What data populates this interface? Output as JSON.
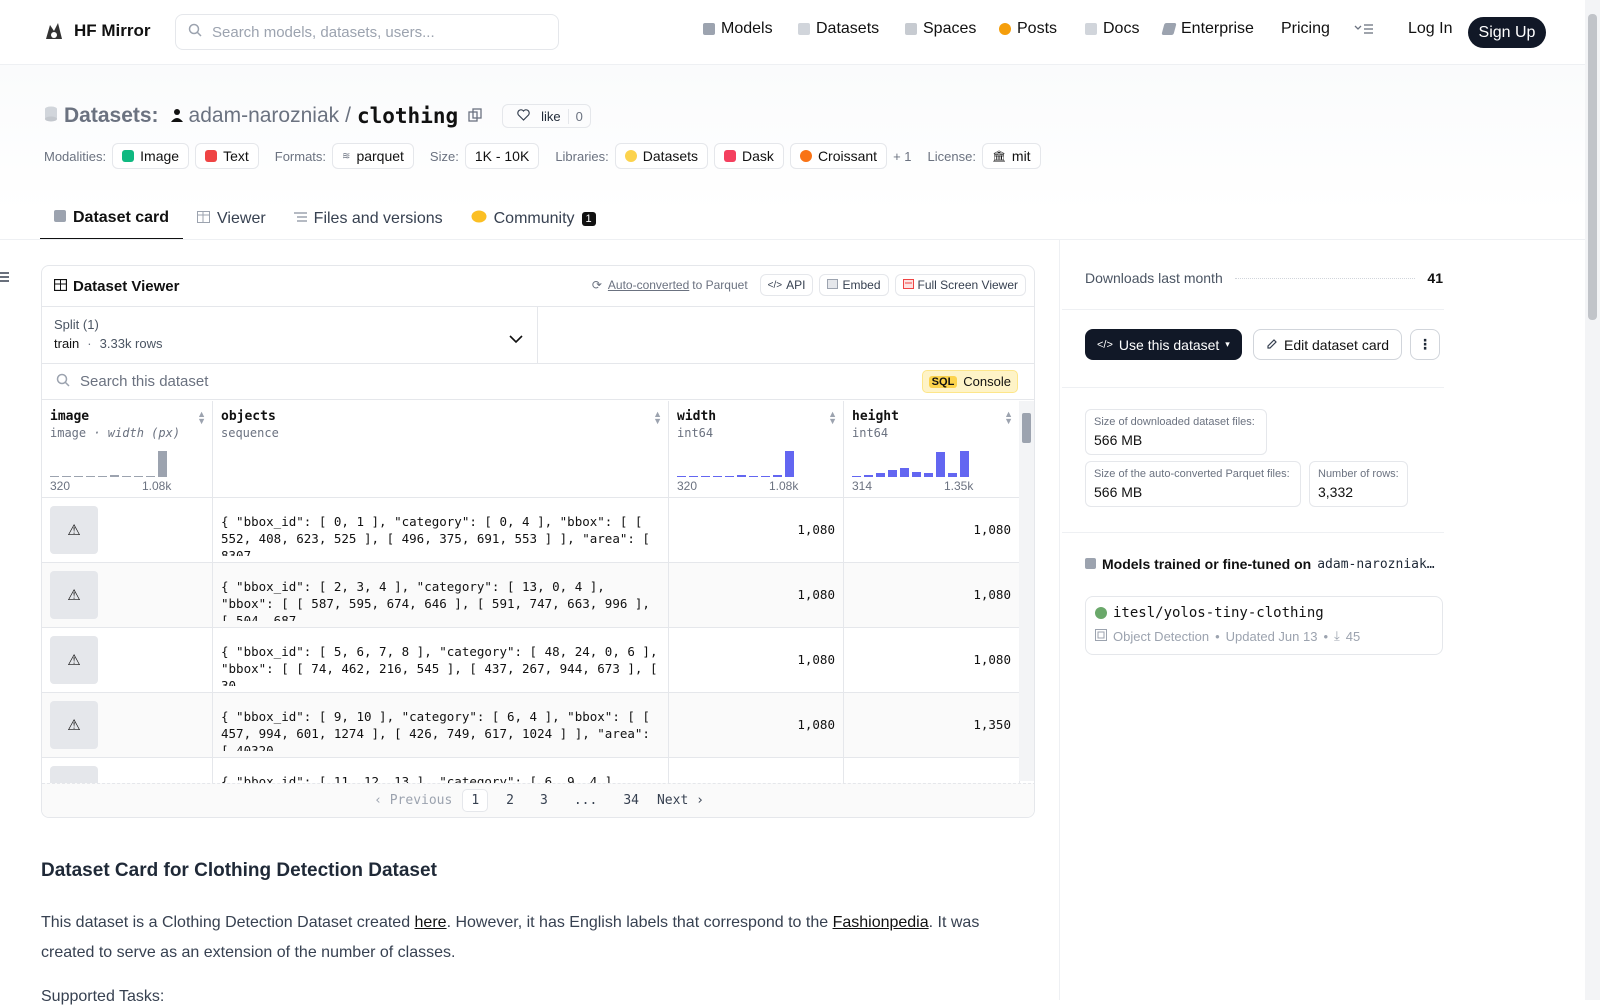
{
  "brand": "HF Mirror",
  "search": {
    "placeholder": "Search models, datasets, users..."
  },
  "nav": {
    "models": "Models",
    "datasets": "Datasets",
    "spaces": "Spaces",
    "posts": "Posts",
    "docs": "Docs",
    "enterprise": "Enterprise",
    "pricing": "Pricing",
    "login": "Log In",
    "signup": "Sign Up"
  },
  "repo": {
    "type_label": "Datasets:",
    "owner": "adam-narozniak",
    "sep": "/",
    "name": "clothing",
    "like": "like",
    "likes": "0"
  },
  "meta": {
    "modalities_label": "Modalities:",
    "modalities": [
      "Image",
      "Text"
    ],
    "formats_label": "Formats:",
    "format": "parquet",
    "size_label": "Size:",
    "size": "1K - 10K",
    "libraries_label": "Libraries:",
    "libraries": [
      "Datasets",
      "Dask",
      "Croissant"
    ],
    "libraries_more": "+ 1",
    "license_label": "License:",
    "license": "mit"
  },
  "tabs": {
    "card": "Dataset card",
    "viewer": "Viewer",
    "files": "Files and versions",
    "community": "Community",
    "community_count": "1"
  },
  "viewer": {
    "title": "Dataset Viewer",
    "auto_converted": "Auto-converted",
    "to_parquet": "to Parquet",
    "api": "API",
    "embed": "Embed",
    "fullscreen": "Full Screen Viewer",
    "split_label": "Split (1)",
    "split_name": "train",
    "split_dot": "·",
    "split_rows": "3.33k rows",
    "search_placeholder": "Search this dataset",
    "sql_tag": "SQL",
    "console": "Console",
    "columns": [
      {
        "name": "image",
        "type": "image",
        "subtype": "· width (px)",
        "min": "320",
        "max": "1.08k"
      },
      {
        "name": "objects",
        "type": "sequence"
      },
      {
        "name": "width",
        "type": "int64",
        "min": "320",
        "max": "1.08k"
      },
      {
        "name": "height",
        "type": "int64",
        "min": "314",
        "max": "1.35k"
      }
    ],
    "rows": [
      {
        "objects": "{ \"bbox_id\": [ 0, 1 ], \"category\": [ 0, 4 ], \"bbox\": [ [ 552, 408, 623, 525 ], [ 496, 375, 691, 553 ] ], \"area\": [ 8307,…",
        "width": "1,080",
        "height": "1,080"
      },
      {
        "objects": "{ \"bbox_id\": [ 2, 3, 4 ], \"category\": [ 13, 0, 4 ], \"bbox\": [ [ 587, 595, 674, 646 ], [ 591, 747, 663, 996 ], [ 504, 687,…",
        "width": "1,080",
        "height": "1,080"
      },
      {
        "objects": "{ \"bbox_id\": [ 5, 6, 7, 8 ], \"category\": [ 48, 24, 0, 6 ], \"bbox\": [ [ 74, 462, 216, 545 ], [ 437, 267, 944, 673 ], [ 30…",
        "width": "1,080",
        "height": "1,080"
      },
      {
        "objects": "{ \"bbox_id\": [ 9, 10 ], \"category\": [ 6, 4 ], \"bbox\": [ [ 457, 994, 601, 1274 ], [ 426, 749, 617, 1024 ] ], \"area\": [ 40320,…",
        "width": "1,080",
        "height": "1,350"
      },
      {
        "objects": "{ \"bbox_id\": [ 11, 12, 13 ], \"category\": [ 6, 9, 4 ], \"bbox\":",
        "width": "",
        "height": ""
      }
    ],
    "pager": {
      "prev": "Previous",
      "pages": [
        "1",
        "2",
        "3",
        "...",
        "34"
      ],
      "next": "Next"
    }
  },
  "card": {
    "heading": "Dataset Card for Clothing Detection Dataset",
    "p1_a": "This dataset is a Clothing Detection Dataset created ",
    "p1_link1": "here",
    "p1_b": ". However, it has English labels that correspond to the ",
    "p1_link2": "Fashionpedia",
    "p1_c": ". It was created to serve as an extension of the number of classes.",
    "next": "Supported Tasks:"
  },
  "sidebar": {
    "downloads_label": "Downloads last month",
    "downloads": "41",
    "use_btn": "Use this dataset",
    "edit_btn": "Edit dataset card",
    "dl_size_label": "Size of downloaded dataset files:",
    "dl_size": "566 MB",
    "pq_size_label": "Size of the auto-converted Parquet files:",
    "pq_size": "566 MB",
    "rows_label": "Number of rows:",
    "rows": "3,332",
    "models_heading": "Models trained or fine-tuned on",
    "models_owner": "adam-narozniak…",
    "model_name": "itesl/yolos-tiny-clothing",
    "model_task": "Object Detection",
    "model_updated": "Updated Jun 13",
    "model_downloads": "45"
  }
}
